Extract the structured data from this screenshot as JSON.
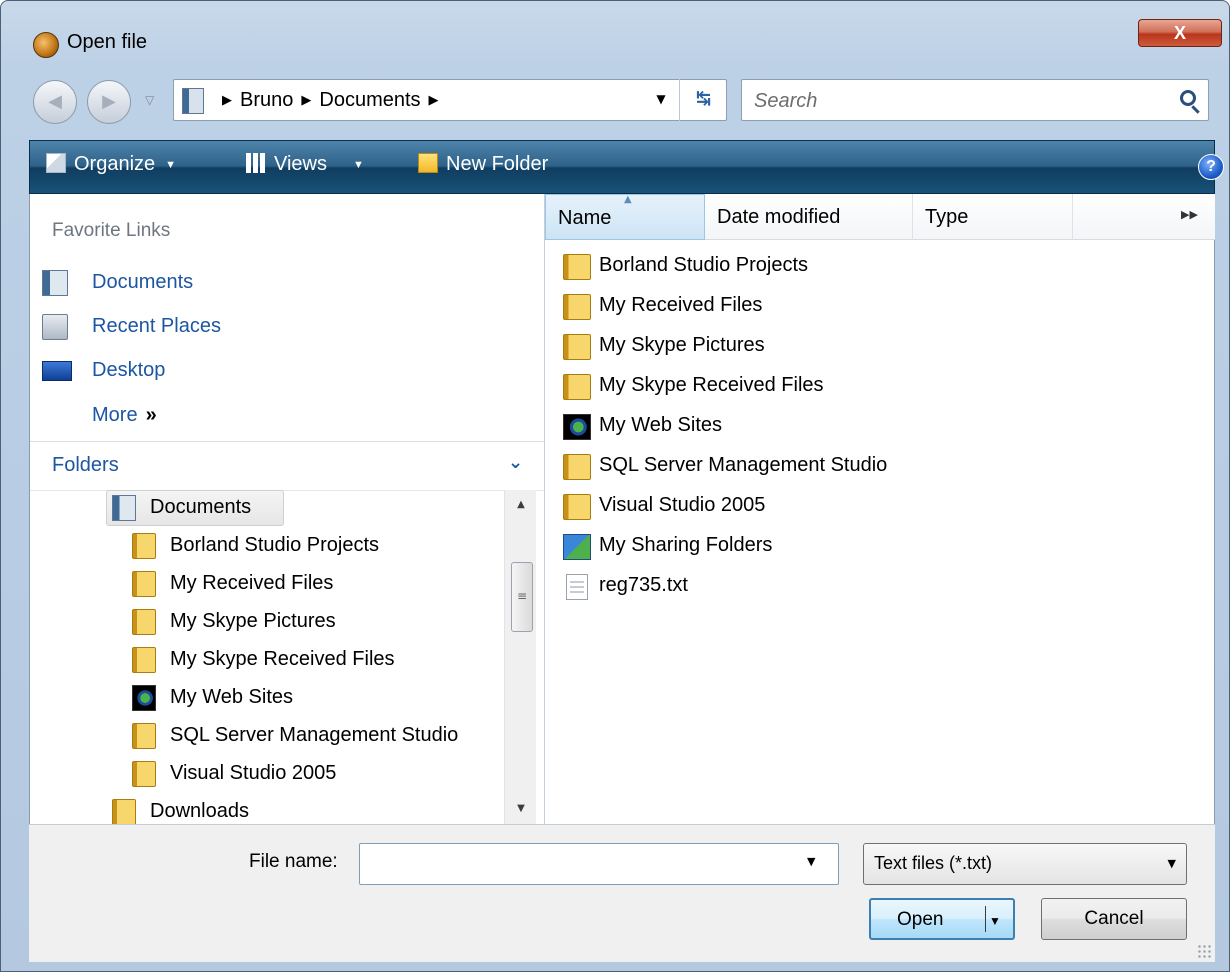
{
  "window": {
    "title": "Open file",
    "close_label": "X"
  },
  "navigation": {
    "back_icon": "back-arrow-icon",
    "forward_icon": "forward-arrow-icon",
    "breadcrumbs": [
      "Bruno",
      "Documents"
    ],
    "search_placeholder": "Search"
  },
  "toolbar": {
    "organize_label": "Organize",
    "views_label": "Views",
    "new_folder_label": "New Folder",
    "help_label": "?"
  },
  "favorites": {
    "header": "Favorite Links",
    "items": [
      {
        "label": "Documents",
        "icon": "documents-icon"
      },
      {
        "label": "Recent Places",
        "icon": "recent-places-icon"
      },
      {
        "label": "Desktop",
        "icon": "desktop-icon"
      }
    ],
    "more_label": "More",
    "more_glyph": "»"
  },
  "folders": {
    "header": "Folders",
    "tree": [
      {
        "label": "Documents",
        "icon": "documents-icon",
        "selected": true
      },
      {
        "label": "Borland Studio Projects",
        "icon": "folder-icon"
      },
      {
        "label": "My Received Files",
        "icon": "folder-icon"
      },
      {
        "label": "My Skype Pictures",
        "icon": "folder-icon"
      },
      {
        "label": "My Skype Received Files",
        "icon": "folder-icon"
      },
      {
        "label": "My Web Sites",
        "icon": "web-sites-icon"
      },
      {
        "label": "SQL Server Management Studio",
        "icon": "folder-icon"
      },
      {
        "label": "Visual Studio 2005",
        "icon": "folder-icon"
      },
      {
        "label": "Downloads",
        "icon": "folder-icon"
      }
    ]
  },
  "file_list": {
    "columns": [
      "Name",
      "Date modified",
      "Type"
    ],
    "items": [
      {
        "label": "Borland Studio Projects",
        "icon": "folder-icon"
      },
      {
        "label": "My Received Files",
        "icon": "folder-icon"
      },
      {
        "label": "My Skype Pictures",
        "icon": "folder-icon"
      },
      {
        "label": "My Skype Received Files",
        "icon": "folder-icon"
      },
      {
        "label": "My Web Sites",
        "icon": "web-sites-icon"
      },
      {
        "label": "SQL Server Management Studio",
        "icon": "folder-icon"
      },
      {
        "label": "Visual Studio 2005",
        "icon": "folder-icon"
      },
      {
        "label": "My Sharing Folders",
        "icon": "sharing-folder-icon"
      },
      {
        "label": "reg735.txt",
        "icon": "text-file-icon"
      }
    ]
  },
  "bottom": {
    "file_name_label": "File name:",
    "file_name_value": "",
    "filter_value": "Text files (*.txt)",
    "open_label": "Open",
    "cancel_label": "Cancel"
  },
  "colors": {
    "toolbar_top": "#4e83ab",
    "toolbar_bottom": "#0f3d5f",
    "link_blue": "#1c56a3",
    "folder_yellow": "#f7d66b"
  }
}
